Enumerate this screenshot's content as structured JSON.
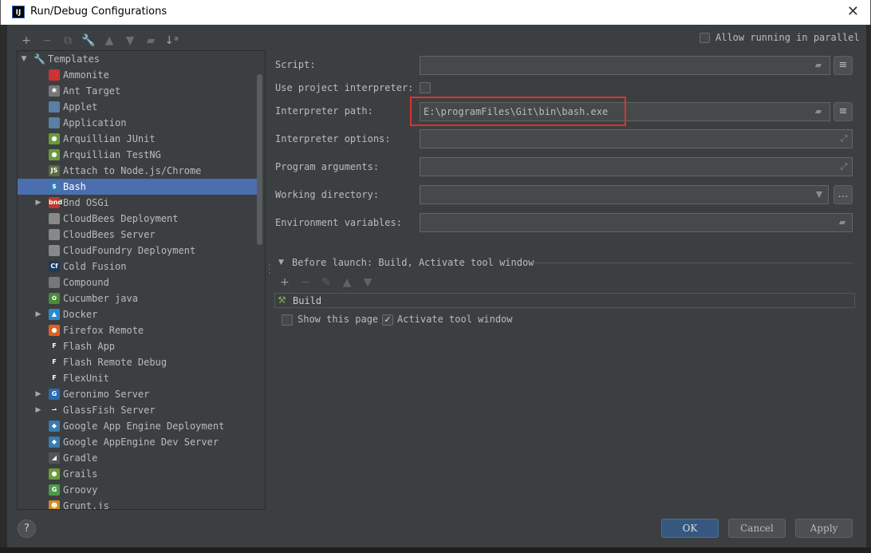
{
  "window": {
    "title": "Run/Debug Configurations",
    "icon": "IJ"
  },
  "toolbar": [
    "add-icon",
    "remove-icon",
    "copy-icon",
    "wrench-icon",
    "move-up-icon",
    "move-down-icon",
    "folder-icon",
    "sort-icon"
  ],
  "tree": {
    "root": "Templates",
    "items": [
      {
        "label": "Ammonite",
        "icon": "ammonite-icon",
        "color": "#c33",
        "glyph": "",
        "expandable": false
      },
      {
        "label": "Ant Target",
        "icon": "ant-icon",
        "color": "#777",
        "glyph": "✱",
        "expandable": false
      },
      {
        "label": "Applet",
        "icon": "applet-icon",
        "color": "#5a7fa6",
        "glyph": "",
        "expandable": false
      },
      {
        "label": "Application",
        "icon": "application-icon",
        "color": "#5a7fa6",
        "glyph": "",
        "expandable": false
      },
      {
        "label": "Arquillian JUnit",
        "icon": "arquillian-icon",
        "color": "#6a9a3a",
        "glyph": "●",
        "expandable": false
      },
      {
        "label": "Arquillian TestNG",
        "icon": "arquillian-icon",
        "color": "#6a9a3a",
        "glyph": "●",
        "expandable": false
      },
      {
        "label": "Attach to Node.js/Chrome",
        "icon": "nodejs-icon",
        "color": "#5a6a40",
        "glyph": "JS",
        "expandable": false
      },
      {
        "label": "Bash",
        "icon": "bash-icon",
        "color": "#3a7ab0",
        "glyph": "$",
        "expandable": false
      },
      {
        "label": "Bnd OSGi",
        "icon": "bnd-icon",
        "color": "#c0392b",
        "glyph": "bnd",
        "expandable": true
      },
      {
        "label": "CloudBees Deployment",
        "icon": "cloudbees-icon",
        "color": "#888",
        "glyph": "",
        "expandable": false
      },
      {
        "label": "CloudBees Server",
        "icon": "cloudbees-icon",
        "color": "#888",
        "glyph": "",
        "expandable": false
      },
      {
        "label": "CloudFoundry Deployment",
        "icon": "cloudfoundry-icon",
        "color": "#888",
        "glyph": "",
        "expandable": false
      },
      {
        "label": "Cold Fusion",
        "icon": "coldfusion-icon",
        "color": "#1d3a5a",
        "glyph": "Cf",
        "expandable": false
      },
      {
        "label": "Compound",
        "icon": "compound-icon",
        "color": "#777",
        "glyph": "",
        "expandable": false
      },
      {
        "label": "Cucumber java",
        "icon": "cucumber-icon",
        "color": "#4a8a3a",
        "glyph": "✿",
        "expandable": false
      },
      {
        "label": "Docker",
        "icon": "docker-icon",
        "color": "#2a8ad0",
        "glyph": "▲",
        "expandable": true
      },
      {
        "label": "Firefox Remote",
        "icon": "firefox-icon",
        "color": "#e06020",
        "glyph": "●",
        "expandable": false
      },
      {
        "label": "Flash App",
        "icon": "flash-icon",
        "color": "#3c3f41",
        "glyph": "F",
        "expandable": false
      },
      {
        "label": "Flash Remote Debug",
        "icon": "flash-icon",
        "color": "#3c3f41",
        "glyph": "F",
        "expandable": false
      },
      {
        "label": "FlexUnit",
        "icon": "flexunit-icon",
        "color": "#3c3f41",
        "glyph": "F",
        "expandable": false
      },
      {
        "label": "Geronimo Server",
        "icon": "geronimo-icon",
        "color": "#2a6ab0",
        "glyph": "G",
        "expandable": true
      },
      {
        "label": "GlassFish Server",
        "icon": "glassfish-icon",
        "color": "#3c3f41",
        "glyph": "⇀",
        "expandable": true
      },
      {
        "label": "Google App Engine Deployment",
        "icon": "appengine-icon",
        "color": "#3a7ab0",
        "glyph": "◆",
        "expandable": false
      },
      {
        "label": "Google AppEngine Dev Server",
        "icon": "appengine-icon",
        "color": "#3a7ab0",
        "glyph": "◆",
        "expandable": false
      },
      {
        "label": "Gradle",
        "icon": "gradle-icon",
        "color": "#555",
        "glyph": "◢",
        "expandable": false
      },
      {
        "label": "Grails",
        "icon": "grails-icon",
        "color": "#6a9a3a",
        "glyph": "●",
        "expandable": false
      },
      {
        "label": "Groovy",
        "icon": "groovy-icon",
        "color": "#4a9a4a",
        "glyph": "G",
        "expandable": false
      },
      {
        "label": "Grunt.js",
        "icon": "grunt-icon",
        "color": "#d08a20",
        "glyph": "☻",
        "expandable": false
      }
    ],
    "selected_index": 7
  },
  "allow_parallel": {
    "label": "Allow running in parallel",
    "checked": false
  },
  "form": {
    "script": {
      "label": "Script:",
      "value": ""
    },
    "use_project_interpreter": {
      "label": "Use project interpreter:",
      "checked": false
    },
    "interpreter_path": {
      "label": "Interpreter path:",
      "value": "E:\\programFiles\\Git\\bin\\bash.exe"
    },
    "interpreter_options": {
      "label": "Interpreter options:",
      "value": ""
    },
    "program_arguments": {
      "label": "Program arguments:",
      "value": ""
    },
    "working_directory": {
      "label": "Working directory:",
      "value": ""
    },
    "environment_variables": {
      "label": "Environment variables:",
      "value": ""
    }
  },
  "before_launch": {
    "title": "Before launch: Build, Activate tool window",
    "tasks": [
      "Build"
    ],
    "show_this_page": {
      "label": "Show this page",
      "checked": false
    },
    "activate_tool_window": {
      "label": "Activate tool window",
      "checked": true
    }
  },
  "buttons": {
    "help": "?",
    "ok": "OK",
    "cancel": "Cancel",
    "apply": "Apply"
  },
  "colors": {
    "selection": "#4b6eaf",
    "highlight": "#e03030",
    "primary_button": "#365880"
  }
}
